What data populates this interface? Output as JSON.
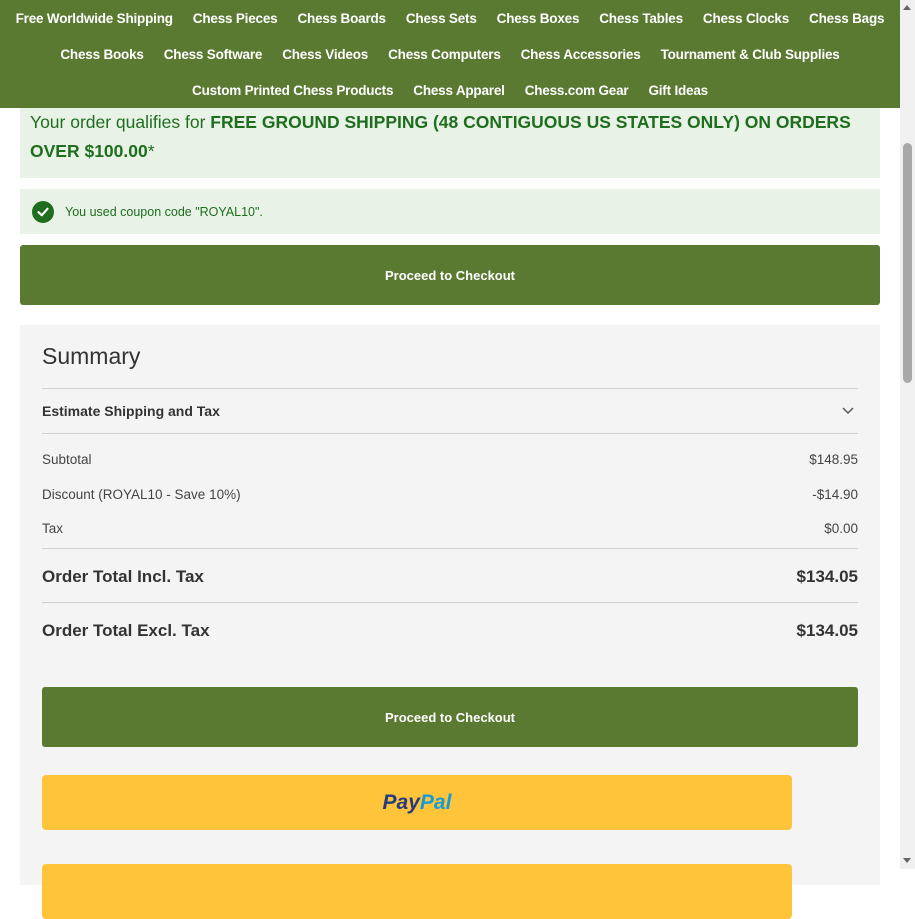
{
  "nav": {
    "row1": [
      "Free Worldwide Shipping",
      "Chess Pieces",
      "Chess Boards",
      "Chess Sets",
      "Chess Boxes",
      "Chess Tables",
      "Chess Clocks",
      "Chess Bags"
    ],
    "row2": [
      "Chess Books",
      "Chess Software",
      "Chess Videos",
      "Chess Computers",
      "Chess Accessories",
      "Tournament & Club Supplies"
    ],
    "row3": [
      "Custom Printed Chess Products",
      "Chess Apparel",
      "Chess.com Gear",
      "Gift Ideas"
    ]
  },
  "promo": {
    "prefix": "Your order qualifies for ",
    "bold_line1": "FREE GROUND SHIPPING (48 CONTIGUOUS US STATES ONLY) ON ORDERS",
    "bold_line2": "OVER $100.00",
    "suffix": "*"
  },
  "coupon": {
    "message": "You used coupon code \"ROYAL10\"."
  },
  "checkout_label": "Proceed to Checkout",
  "summary": {
    "title": "Summary",
    "estimate_label": "Estimate Shipping and Tax",
    "rows": [
      {
        "label": "Subtotal",
        "value": "$148.95"
      },
      {
        "label": "Discount (ROYAL10 - Save 10%)",
        "value": "-$14.90"
      },
      {
        "label": "Tax",
        "value": "$0.00"
      }
    ],
    "total_incl": {
      "label": "Order Total Incl. Tax",
      "value": "$134.05"
    },
    "total_excl": {
      "label": "Order Total Excl. Tax",
      "value": "$134.05"
    }
  },
  "paypal": {
    "word1": "Pay",
    "word2": "Pal"
  },
  "colors": {
    "brand_green": "#5a7a32",
    "success_green": "#1e6e1e",
    "paypal_yellow": "#ffc439"
  }
}
